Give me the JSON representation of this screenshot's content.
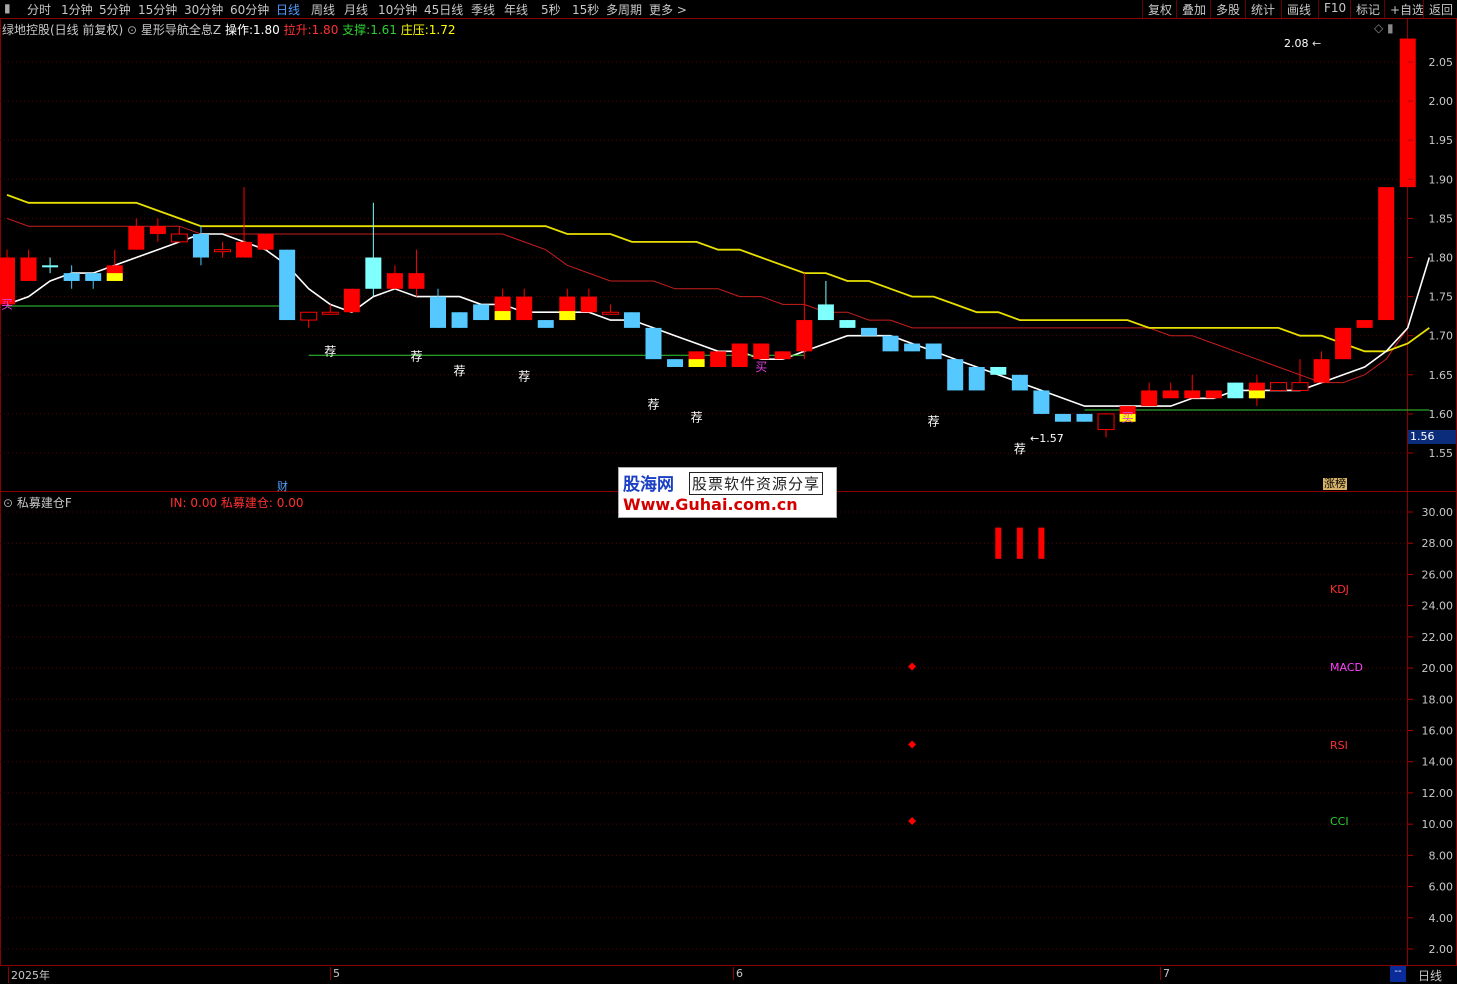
{
  "toolbar": {
    "menu_glyph": "▮",
    "periods": [
      "分时",
      "1分钟",
      "5分钟",
      "15分钟",
      "30分钟",
      "60分钟",
      "日线",
      "周线",
      "月线",
      "10分钟",
      "45日线",
      "季线",
      "年线",
      "5秒",
      "15秒",
      "多周期",
      "更多 >"
    ],
    "active_period": "日线",
    "right_buttons": [
      "复权",
      "叠加",
      "多股",
      "统计",
      "画线",
      "F10",
      "标记",
      "+自选",
      "返回"
    ]
  },
  "main_header": {
    "stock": "绿地控股(日线 前复权)",
    "indicator": "星形导航全息Z",
    "op_label": "操作:",
    "op_value": "1.80",
    "lift_label": "拉升:",
    "lift_value": "1.80",
    "support_label": "支撑:",
    "support_value": "1.61",
    "press_label": "庄压:",
    "press_value": "1.72",
    "corner_icons": "◇ ▮"
  },
  "price_axis": {
    "ticks": [
      "2.05",
      "2.00",
      "1.95",
      "1.90",
      "1.85",
      "1.80",
      "1.75",
      "1.70",
      "1.65",
      "1.60",
      "1.55"
    ],
    "current": "1.56"
  },
  "chart_labels": {
    "high": "2.08",
    "low": "1.57",
    "buy": "买",
    "recommend": "荐",
    "finance": "财",
    "limit_up": "涨榜"
  },
  "indicator_header": {
    "name": "私募建仓F",
    "in_label": "IN: 0.00",
    "build_label": "私募建仓: 0.00"
  },
  "indicator_axis": {
    "ticks": [
      "30.00",
      "28.00",
      "26.00",
      "24.00",
      "22.00",
      "20.00",
      "18.00",
      "16.00",
      "14.00",
      "12.00",
      "10.00",
      "8.00",
      "6.00",
      "4.00",
      "2.00"
    ]
  },
  "indicator_labels": [
    {
      "text": "KDJ",
      "color": "#ff3030"
    },
    {
      "text": "MACD",
      "color": "#ff40ff"
    },
    {
      "text": "RSI",
      "color": "#ff3030"
    },
    {
      "text": "CCI",
      "color": "#30d030"
    }
  ],
  "time_axis": {
    "labels": [
      "2025年",
      "5",
      "6",
      "7"
    ],
    "corner": "--",
    "period": "日线"
  },
  "watermark": {
    "brand": "股海网",
    "slogan": "股票软件资源分享",
    "url": "Www.Guhai.com.cn"
  },
  "colors": {
    "up": "#ff0000",
    "down": "#54c8ff",
    "cyan_down": "#80ffff",
    "yellow": "#ffff00",
    "ma_white": "#ffffff",
    "ma_yellow": "#e8e000",
    "ma_red": "#c81e1e",
    "support_green": "#33cc33"
  },
  "chart_data": {
    "type": "candlestick",
    "y_range": [
      1.53,
      2.1
    ],
    "candles": [
      {
        "o": 1.8,
        "h": 1.81,
        "l": 1.75,
        "c": 1.74,
        "k": "up"
      },
      {
        "o": 1.8,
        "h": 1.81,
        "l": 1.78,
        "c": 1.77,
        "k": "up"
      },
      {
        "o": 1.79,
        "h": 1.8,
        "l": 1.78,
        "c": 1.79,
        "k": "cyan"
      },
      {
        "o": 1.78,
        "h": 1.79,
        "l": 1.76,
        "c": 1.77,
        "k": "down"
      },
      {
        "o": 1.77,
        "h": 1.78,
        "l": 1.76,
        "c": 1.78,
        "k": "down"
      },
      {
        "o": 1.77,
        "h": 1.81,
        "l": 1.77,
        "c": 1.79,
        "k": "up",
        "y": true
      },
      {
        "o": 1.81,
        "h": 1.85,
        "l": 1.81,
        "c": 1.84,
        "k": "up"
      },
      {
        "o": 1.83,
        "h": 1.85,
        "l": 1.82,
        "c": 1.84,
        "k": "up"
      },
      {
        "o": 1.82,
        "h": 1.84,
        "l": 1.82,
        "c": 1.83,
        "k": "hollow"
      },
      {
        "o": 1.83,
        "h": 1.84,
        "l": 1.79,
        "c": 1.8,
        "k": "down"
      },
      {
        "o": 1.81,
        "h": 1.82,
        "l": 1.8,
        "c": 1.81,
        "k": "hollow"
      },
      {
        "o": 1.82,
        "h": 1.89,
        "l": 1.8,
        "c": 1.8,
        "k": "up"
      },
      {
        "o": 1.81,
        "h": 1.83,
        "l": 1.81,
        "c": 1.83,
        "k": "up"
      },
      {
        "o": 1.81,
        "h": 1.81,
        "l": 1.72,
        "c": 1.72,
        "k": "down"
      },
      {
        "o": 1.73,
        "h": 1.73,
        "l": 1.71,
        "c": 1.72,
        "k": "hollow"
      },
      {
        "o": 1.73,
        "h": 1.74,
        "l": 1.73,
        "c": 1.73,
        "k": "hollow"
      },
      {
        "o": 1.76,
        "h": 1.76,
        "l": 1.73,
        "c": 1.73,
        "k": "up"
      },
      {
        "o": 1.8,
        "h": 1.87,
        "l": 1.75,
        "c": 1.76,
        "k": "cyan"
      },
      {
        "o": 1.78,
        "h": 1.79,
        "l": 1.76,
        "c": 1.76,
        "k": "up"
      },
      {
        "o": 1.76,
        "h": 1.81,
        "l": 1.75,
        "c": 1.78,
        "k": "up"
      },
      {
        "o": 1.75,
        "h": 1.76,
        "l": 1.71,
        "c": 1.71,
        "k": "down"
      },
      {
        "o": 1.73,
        "h": 1.73,
        "l": 1.71,
        "c": 1.71,
        "k": "down"
      },
      {
        "o": 1.74,
        "h": 1.74,
        "l": 1.72,
        "c": 1.72,
        "k": "down"
      },
      {
        "o": 1.75,
        "h": 1.76,
        "l": 1.72,
        "c": 1.72,
        "k": "up",
        "y": true
      },
      {
        "o": 1.75,
        "h": 1.76,
        "l": 1.72,
        "c": 1.72,
        "k": "up"
      },
      {
        "o": 1.72,
        "h": 1.72,
        "l": 1.71,
        "c": 1.71,
        "k": "down"
      },
      {
        "o": 1.75,
        "h": 1.76,
        "l": 1.73,
        "c": 1.72,
        "k": "up",
        "y": true
      },
      {
        "o": 1.75,
        "h": 1.76,
        "l": 1.73,
        "c": 1.73,
        "k": "up"
      },
      {
        "o": 1.73,
        "h": 1.74,
        "l": 1.73,
        "c": 1.73,
        "k": "hollow"
      },
      {
        "o": 1.73,
        "h": 1.73,
        "l": 1.71,
        "c": 1.71,
        "k": "down"
      },
      {
        "o": 1.71,
        "h": 1.71,
        "l": 1.67,
        "c": 1.67,
        "k": "down"
      },
      {
        "o": 1.67,
        "h": 1.67,
        "l": 1.66,
        "c": 1.66,
        "k": "down"
      },
      {
        "o": 1.68,
        "h": 1.68,
        "l": 1.66,
        "c": 1.66,
        "k": "up",
        "y": true
      },
      {
        "o": 1.68,
        "h": 1.68,
        "l": 1.66,
        "c": 1.66,
        "k": "up"
      },
      {
        "o": 1.69,
        "h": 1.69,
        "l": 1.66,
        "c": 1.66,
        "k": "up"
      },
      {
        "o": 1.69,
        "h": 1.69,
        "l": 1.67,
        "c": 1.67,
        "k": "up"
      },
      {
        "o": 1.68,
        "h": 1.68,
        "l": 1.67,
        "c": 1.67,
        "k": "up"
      },
      {
        "o": 1.72,
        "h": 1.78,
        "l": 1.67,
        "c": 1.68,
        "k": "up"
      },
      {
        "o": 1.74,
        "h": 1.77,
        "l": 1.72,
        "c": 1.72,
        "k": "cyan"
      },
      {
        "o": 1.72,
        "h": 1.72,
        "l": 1.71,
        "c": 1.71,
        "k": "cyan"
      },
      {
        "o": 1.71,
        "h": 1.71,
        "l": 1.7,
        "c": 1.7,
        "k": "down"
      },
      {
        "o": 1.7,
        "h": 1.7,
        "l": 1.68,
        "c": 1.68,
        "k": "down"
      },
      {
        "o": 1.69,
        "h": 1.69,
        "l": 1.68,
        "c": 1.68,
        "k": "down"
      },
      {
        "o": 1.69,
        "h": 1.69,
        "l": 1.67,
        "c": 1.67,
        "k": "down"
      },
      {
        "o": 1.67,
        "h": 1.67,
        "l": 1.63,
        "c": 1.63,
        "k": "down"
      },
      {
        "o": 1.66,
        "h": 1.66,
        "l": 1.63,
        "c": 1.63,
        "k": "down"
      },
      {
        "o": 1.66,
        "h": 1.66,
        "l": 1.65,
        "c": 1.65,
        "k": "cyan"
      },
      {
        "o": 1.65,
        "h": 1.65,
        "l": 1.63,
        "c": 1.63,
        "k": "down"
      },
      {
        "o": 1.63,
        "h": 1.63,
        "l": 1.6,
        "c": 1.6,
        "k": "down"
      },
      {
        "o": 1.6,
        "h": 1.6,
        "l": 1.59,
        "c": 1.59,
        "k": "down"
      },
      {
        "o": 1.6,
        "h": 1.6,
        "l": 1.59,
        "c": 1.59,
        "k": "down"
      },
      {
        "o": 1.6,
        "h": 1.6,
        "l": 1.57,
        "c": 1.58,
        "k": "hollow"
      },
      {
        "o": 1.61,
        "h": 1.61,
        "l": 1.59,
        "c": 1.59,
        "k": "up",
        "y": true
      },
      {
        "o": 1.63,
        "h": 1.64,
        "l": 1.61,
        "c": 1.61,
        "k": "up"
      },
      {
        "o": 1.63,
        "h": 1.64,
        "l": 1.62,
        "c": 1.62,
        "k": "up"
      },
      {
        "o": 1.63,
        "h": 1.65,
        "l": 1.62,
        "c": 1.62,
        "k": "up"
      },
      {
        "o": 1.63,
        "h": 1.63,
        "l": 1.62,
        "c": 1.62,
        "k": "up"
      },
      {
        "o": 1.64,
        "h": 1.64,
        "l": 1.62,
        "c": 1.62,
        "k": "cyan"
      },
      {
        "o": 1.64,
        "h": 1.65,
        "l": 1.61,
        "c": 1.62,
        "k": "up",
        "y": true
      },
      {
        "o": 1.64,
        "h": 1.64,
        "l": 1.63,
        "c": 1.63,
        "k": "hollow"
      },
      {
        "o": 1.64,
        "h": 1.67,
        "l": 1.63,
        "c": 1.63,
        "k": "hollow"
      },
      {
        "o": 1.67,
        "h": 1.68,
        "l": 1.64,
        "c": 1.64,
        "k": "up"
      },
      {
        "o": 1.71,
        "h": 1.71,
        "l": 1.67,
        "c": 1.67,
        "k": "up"
      },
      {
        "o": 1.72,
        "h": 1.72,
        "l": 1.71,
        "c": 1.71,
        "k": "up"
      },
      {
        "o": 1.89,
        "h": 1.89,
        "l": 1.72,
        "c": 1.72,
        "k": "up"
      },
      {
        "o": 2.08,
        "h": 2.08,
        "l": 1.89,
        "c": 1.89,
        "k": "up"
      }
    ],
    "ma_white": [
      1.74,
      1.75,
      1.77,
      1.78,
      1.78,
      1.79,
      1.8,
      1.81,
      1.82,
      1.83,
      1.83,
      1.82,
      1.81,
      1.79,
      1.76,
      1.74,
      1.73,
      1.75,
      1.76,
      1.75,
      1.75,
      1.75,
      1.74,
      1.74,
      1.73,
      1.73,
      1.73,
      1.73,
      1.72,
      1.72,
      1.71,
      1.7,
      1.69,
      1.68,
      1.68,
      1.67,
      1.67,
      1.68,
      1.69,
      1.7,
      1.7,
      1.7,
      1.69,
      1.68,
      1.67,
      1.66,
      1.65,
      1.64,
      1.63,
      1.62,
      1.61,
      1.61,
      1.61,
      1.61,
      1.61,
      1.62,
      1.62,
      1.63,
      1.63,
      1.63,
      1.63,
      1.64,
      1.65,
      1.66,
      1.68,
      1.71,
      1.8
    ],
    "ma_yellow": [
      1.88,
      1.87,
      1.87,
      1.87,
      1.87,
      1.87,
      1.87,
      1.86,
      1.85,
      1.84,
      1.84,
      1.84,
      1.84,
      1.84,
      1.84,
      1.84,
      1.84,
      1.84,
      1.84,
      1.84,
      1.84,
      1.84,
      1.84,
      1.84,
      1.84,
      1.84,
      1.83,
      1.83,
      1.83,
      1.82,
      1.82,
      1.82,
      1.82,
      1.81,
      1.81,
      1.8,
      1.79,
      1.78,
      1.78,
      1.77,
      1.77,
      1.76,
      1.75,
      1.75,
      1.74,
      1.73,
      1.73,
      1.72,
      1.72,
      1.72,
      1.72,
      1.72,
      1.72,
      1.71,
      1.71,
      1.71,
      1.71,
      1.71,
      1.71,
      1.71,
      1.7,
      1.7,
      1.69,
      1.68,
      1.68,
      1.69,
      1.71
    ],
    "ma_red": [
      1.85,
      1.84,
      1.84,
      1.84,
      1.84,
      1.84,
      1.84,
      1.84,
      1.84,
      1.83,
      1.83,
      1.83,
      1.83,
      1.83,
      1.83,
      1.83,
      1.83,
      1.83,
      1.83,
      1.83,
      1.83,
      1.83,
      1.83,
      1.83,
      1.82,
      1.81,
      1.79,
      1.78,
      1.77,
      1.77,
      1.77,
      1.76,
      1.76,
      1.76,
      1.75,
      1.75,
      1.74,
      1.74,
      1.73,
      1.73,
      1.72,
      1.72,
      1.71,
      1.71,
      1.71,
      1.71,
      1.71,
      1.71,
      1.71,
      1.71,
      1.71,
      1.71,
      1.71,
      1.71,
      1.7,
      1.7,
      1.69,
      1.68,
      1.67,
      1.66,
      1.65,
      1.64,
      1.64,
      1.65,
      1.67,
      1.71,
      1.8
    ],
    "support_lines": [
      {
        "from": 0,
        "to": 13,
        "y": 1.738
      },
      {
        "from": 14,
        "to": 37,
        "y": 1.675
      },
      {
        "from": 50,
        "to": 66,
        "y": 1.605
      }
    ],
    "buy_marks": [
      {
        "i": 0,
        "y": 1.735
      },
      {
        "i": 35,
        "y": 1.655
      },
      {
        "i": 52,
        "y": 1.59
      }
    ],
    "recommend_marks": [
      {
        "i": 15,
        "y": 1.675
      },
      {
        "i": 19,
        "y": 1.668
      },
      {
        "i": 21,
        "y": 1.65
      },
      {
        "i": 24,
        "y": 1.643
      },
      {
        "i": 30,
        "y": 1.607
      },
      {
        "i": 32,
        "y": 1.59
      },
      {
        "i": 43,
        "y": 1.585
      },
      {
        "i": 47,
        "y": 1.55
      }
    ],
    "indicator": {
      "y_range": [
        0,
        31
      ],
      "red_bars": [
        {
          "i": 46,
          "from": 27,
          "to": 29
        },
        {
          "i": 47,
          "from": 27,
          "to": 29
        },
        {
          "i": 48,
          "from": 27,
          "to": 29
        }
      ],
      "dots": [
        {
          "i": 42,
          "v": 20.1
        },
        {
          "i": 42,
          "v": 15.1
        },
        {
          "i": 42,
          "v": 10.2
        }
      ]
    }
  }
}
